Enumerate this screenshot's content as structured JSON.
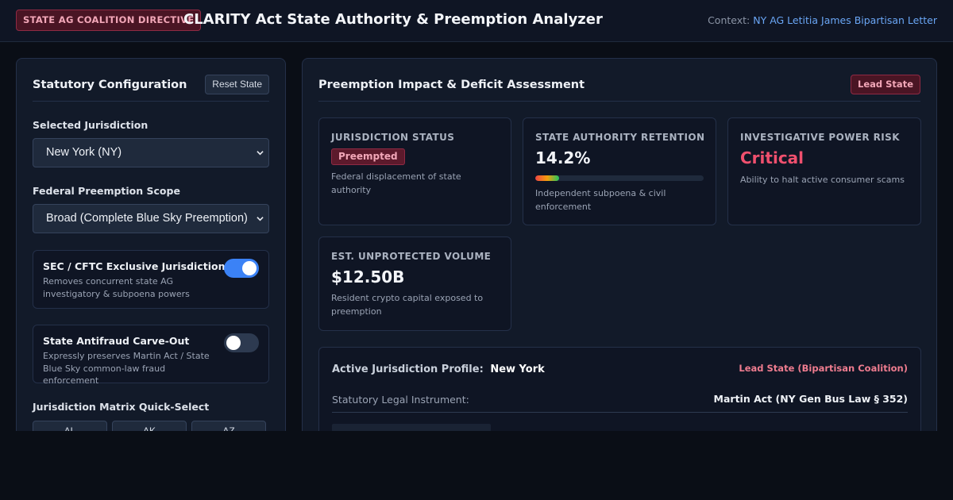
{
  "header": {
    "tag": "STATE AG COALITION DIRECTIVE",
    "title": "CLARITY Act State Authority & Preemption Analyzer",
    "context_label": "Context:",
    "context_link": "NY AG Letitia James Bipartisan Letter"
  },
  "config": {
    "title": "Statutory Configuration",
    "reset_label": "Reset State",
    "jurisdiction_label": "Selected Jurisdiction",
    "jurisdiction_value": "New York (NY)",
    "scope_label": "Federal Preemption Scope",
    "scope_value": "Broad (Complete Blue Sky Preemption)",
    "toggles": [
      {
        "title": "SEC / CFTC Exclusive Jurisdiction",
        "desc": "Removes concurrent state AG investigatory & subpoena powers",
        "on": true
      },
      {
        "title": "State Antifraud Carve-Out",
        "desc": "Expressly preserves Martin Act / State Blue Sky common-law fraud enforcement",
        "on": false
      }
    ],
    "matrix_label": "Jurisdiction Matrix Quick-Select",
    "matrix": [
      "AL",
      "AK",
      "AZ"
    ]
  },
  "impact": {
    "title": "Preemption Impact & Deficit Assessment",
    "badge": "Lead State",
    "status": {
      "label": "JURISDICTION STATUS",
      "value": "Preempted",
      "desc": "Federal displacement of state authority"
    },
    "retention": {
      "label": "STATE AUTHORITY RETENTION",
      "value": "14.2%",
      "percent": 14.2,
      "desc": "Independent subpoena & civil enforcement"
    },
    "risk": {
      "label": "INVESTIGATIVE POWER RISK",
      "value": "Critical",
      "desc": "Ability to halt active consumer scams"
    },
    "volume": {
      "label": "EST. UNPROTECTED VOLUME",
      "value": "$12.50B",
      "desc": "Resident crypto capital exposed to preemption"
    }
  },
  "profile": {
    "heading": "Active Jurisdiction Profile:",
    "state": "New York",
    "lead": "Lead State (Bipartisan Coalition)",
    "instrument_label": "Statutory Legal Instrument:",
    "instrument_value": "Martin Act (NY Gen Bus Law § 352)"
  },
  "colors": {
    "accent": "#3b82f6",
    "danger": "#f0506e",
    "badge_bg": "#4a1524"
  }
}
